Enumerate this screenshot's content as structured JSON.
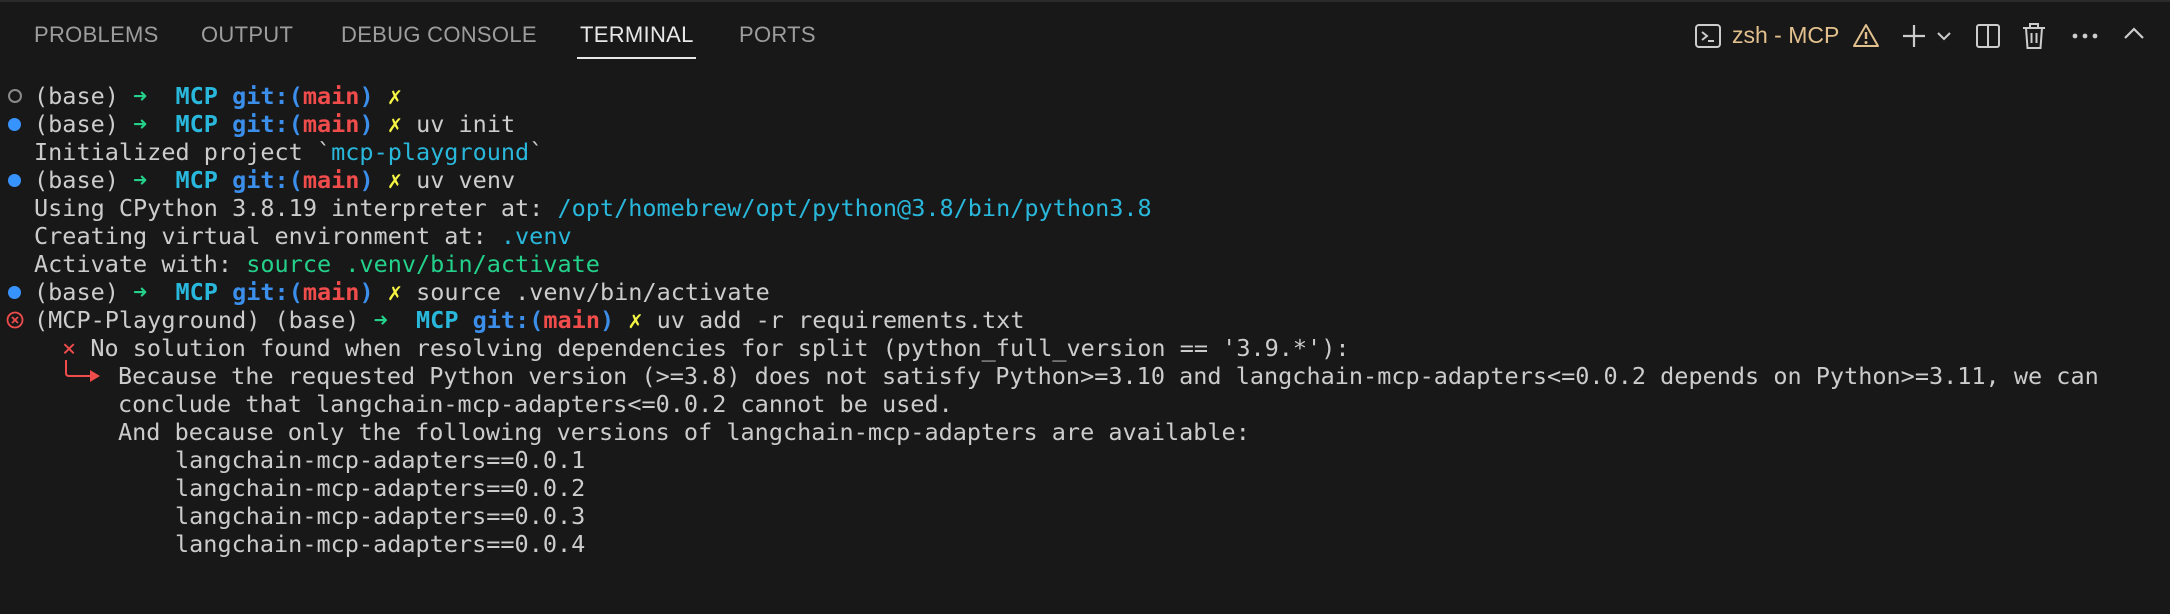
{
  "tabs": [
    {
      "label": "PROBLEMS"
    },
    {
      "label": "OUTPUT"
    },
    {
      "label": "DEBUG CONSOLE"
    },
    {
      "label": "TERMINAL"
    },
    {
      "label": "PORTS"
    }
  ],
  "terminal_instance": {
    "label": "zsh - MCP",
    "icons": [
      "terminal-icon",
      "warning-icon",
      "plus-icon",
      "chevron-down-icon",
      "split-icon",
      "trash-icon",
      "more-icon",
      "chevron-up-icon"
    ]
  },
  "prompt": {
    "base": "(base) ",
    "arrow": "➜",
    "dir": "MCP",
    "git_open": "git:(",
    "branch": "main",
    "git_close": ")",
    "dirty": "✗",
    "venv": "(MCP-Playground) "
  },
  "lines": {
    "l1_cmd": "",
    "l2_cmd": "uv init",
    "l3_a": "Initialized project `",
    "l3_b": "mcp-playground",
    "l3_c": "`",
    "l4_cmd": "uv venv",
    "l5_a": "Using CPython 3.8.19 interpreter at: ",
    "l5_b": "/opt/homebrew/opt/python@3.8/bin/python3.8",
    "l6_a": "Creating virtual environment at: ",
    "l6_b": ".venv",
    "l7_a": "Activate with: ",
    "l7_b": "source .venv/bin/activate",
    "l8_cmd": "source .venv/bin/activate",
    "l9_cmd": "uv add -r requirements.txt",
    "l10_x": "×",
    "l10_text": "No solution found when resolving dependencies for split (python_full_version == '3.9.*'):",
    "l11": "Because the requested Python version (>=3.8) does not satisfy Python>=3.10 and langchain-mcp-adapters<=0.0.2 depends on Python>=3.11, we can",
    "l12": "conclude that langchain-mcp-adapters<=0.0.2 cannot be used.",
    "l13": "And because only the following versions of langchain-mcp-adapters are available:",
    "l14": "langchain-mcp-adapters==0.0.1",
    "l15": "langchain-mcp-adapters==0.0.2",
    "l16": "langchain-mcp-adapters==0.0.3",
    "l17": "langchain-mcp-adapters==0.0.4"
  },
  "colors": {
    "background": "#181818",
    "active_tab": "#e7e7e7",
    "inactive_tab": "#9d9d9d",
    "warning": "#e2c08d",
    "prompt_arrow": "#23d18b",
    "prompt_dir": "#29b8db",
    "prompt_git": "#3b8eea",
    "prompt_branch": "#f14c4c",
    "prompt_dirty": "#f5f543",
    "success_decoration": "#3794ff"
  }
}
